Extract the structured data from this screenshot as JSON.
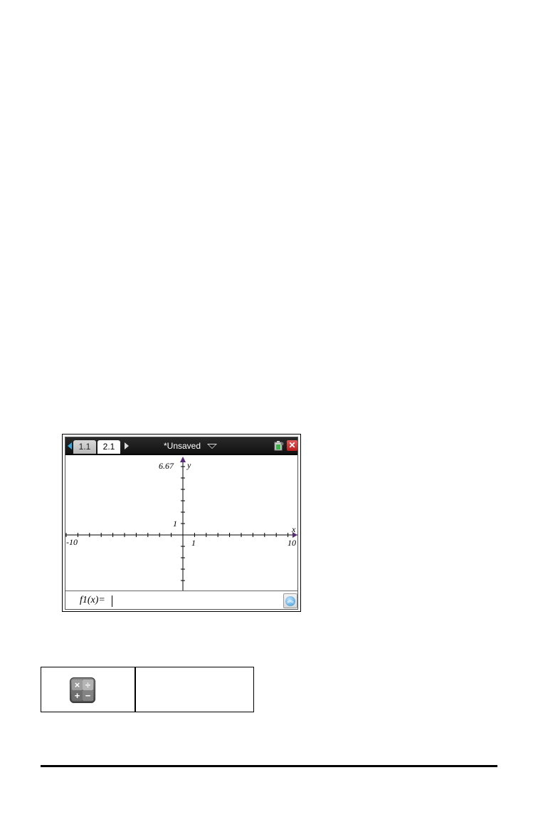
{
  "calculator": {
    "tabs": [
      {
        "label": "1.1",
        "active": false
      },
      {
        "label": "2.1",
        "active": true
      }
    ],
    "document_title": "*Unsaved",
    "graph": {
      "x_min_label": "-10",
      "x_max_label": "10",
      "y_max_label": "6.67",
      "x_tick_label": "1",
      "y_tick_label": "1",
      "x_axis_label": "x",
      "y_axis_label": "y"
    },
    "entry": {
      "text": "f1(x)="
    }
  },
  "icons": {
    "tab_arrow_left": "arrow-left-icon",
    "tab_arrow_right": "arrow-right-icon",
    "document_menu": "chevron-down-icon",
    "battery": "battery-icon",
    "close": "close-icon",
    "expand": "expand-icon",
    "calculator_app": "calculator-icon"
  },
  "colors": {
    "accent_blue": "#39a8e0",
    "close_red": "#c92a2a",
    "axis_arrow": "#5a2a7a"
  }
}
